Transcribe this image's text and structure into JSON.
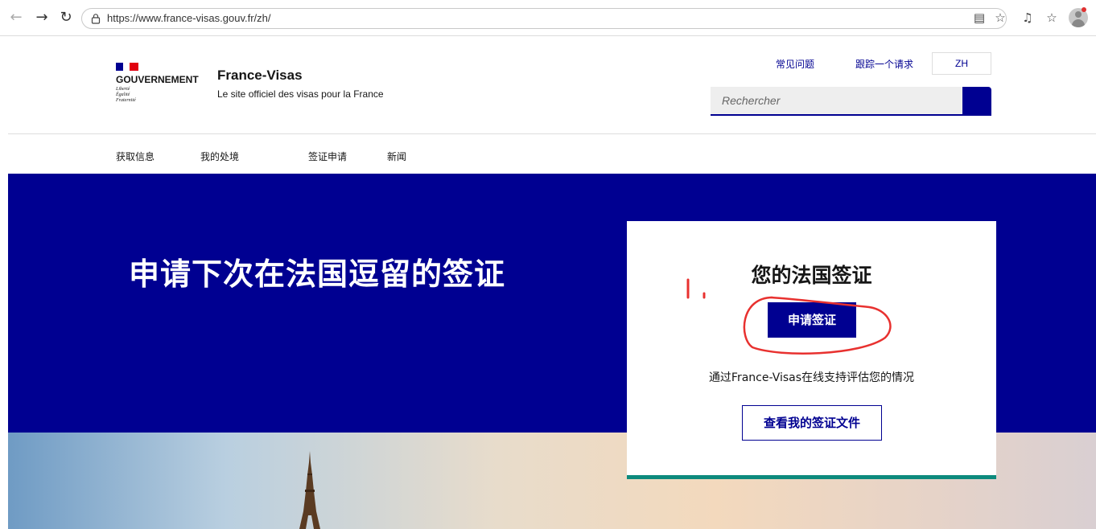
{
  "browser": {
    "url": "https://www.france-visas.gouv.fr/zh/",
    "back_icon": "back-arrow-icon",
    "forward_icon": "forward-arrow-icon",
    "reload_icon": "reload-icon",
    "reader_icon": "reader-mode-icon",
    "favorite_icon": "star-icon",
    "media_icon": "music-note-icon",
    "collections_icon": "favorites-list-icon",
    "profile_icon": "profile-avatar-icon"
  },
  "header": {
    "gov_name": "GOUVERNEMENT",
    "gov_motto": [
      "Liberté",
      "Égalité",
      "Fraternité"
    ],
    "site_title": "France-Visas",
    "site_tagline": "Le site officiel des visas pour la France",
    "links": [
      "常见问题",
      "跟踪一个请求"
    ],
    "language": "ZH",
    "search_placeholder": "Rechercher",
    "colors": {
      "primary": "#000091",
      "accent_green": "#0d8a7d",
      "flag_red": "#e1000f"
    }
  },
  "main_nav": [
    "获取信息",
    "我的处境",
    "签证申请",
    "新闻"
  ],
  "hero": {
    "title": "申请下次在法国逗留的签证"
  },
  "card": {
    "title": "您的法国签证",
    "apply_button": "申请签证",
    "text": "通过France-Visas在线支持评估您的情况",
    "docs_button": "查看我的签证文件"
  },
  "annotation": {
    "label": "1.",
    "color": "#e8312f"
  }
}
